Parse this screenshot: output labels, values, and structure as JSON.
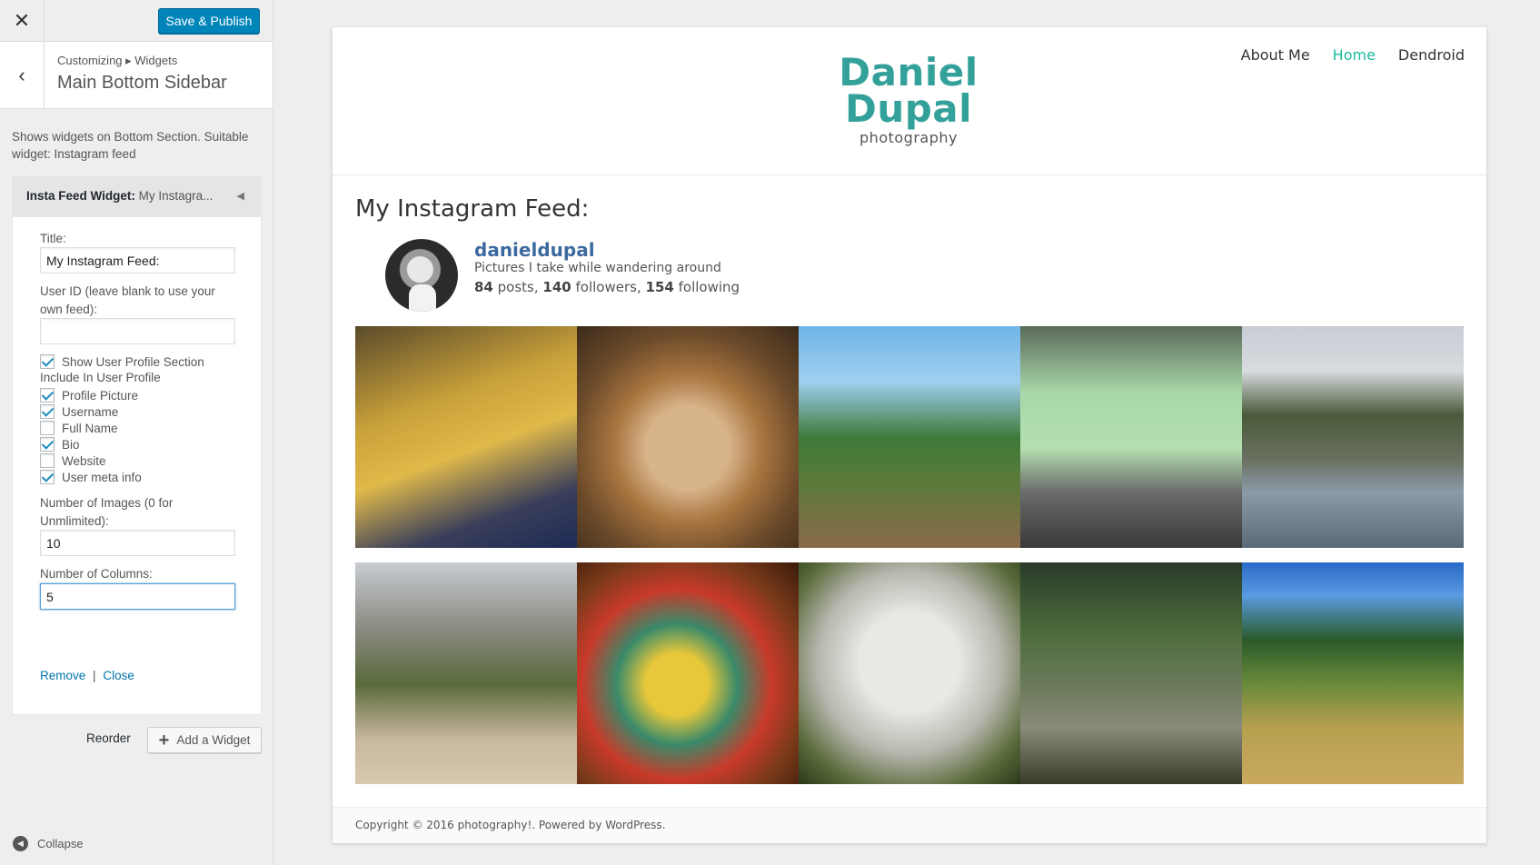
{
  "sidebar": {
    "close_icon": "close-icon",
    "save_label": "Save & Publish",
    "back_icon": "chevron-left-icon",
    "breadcrumb": "Customizing ▸ Widgets",
    "panel_title": "Main Bottom Sidebar",
    "description": "Shows widgets on Bottom Section. Suitable widget: Instagram feed",
    "widget": {
      "name": "Insta Feed Widget",
      "separator": ":",
      "instance_title": "My Instagra...",
      "toggle_icon": "arrow-left-icon",
      "title_label": "Title:",
      "title_value": "My Instagram Feed:",
      "userid_label": "User ID (leave blank to use your own feed):",
      "userid_value": "",
      "show_profile_label": "Show User Profile Section",
      "show_profile_checked": true,
      "include_label": "Include In User Profile",
      "options": [
        {
          "label": "Profile Picture",
          "checked": true
        },
        {
          "label": "Username",
          "checked": true
        },
        {
          "label": "Full Name",
          "checked": false
        },
        {
          "label": "Bio",
          "checked": true
        },
        {
          "label": "Website",
          "checked": false
        },
        {
          "label": "User meta info",
          "checked": true
        }
      ],
      "num_images_label": "Number of Images (0 for Unmlimited):",
      "num_images_value": "10",
      "num_columns_label": "Number of Columns:",
      "num_columns_value": "5",
      "remove_label": "Remove",
      "link_separator": "|",
      "close_label": "Close"
    },
    "reorder_label": "Reorder",
    "add_widget_label": "Add a Widget",
    "collapse_label": "Collapse"
  },
  "site": {
    "logo_line1": "Daniel",
    "logo_line2": "Dupal",
    "logo_line3": "photography",
    "nav": [
      {
        "label": "About Me",
        "active": false
      },
      {
        "label": "Home",
        "active": true
      },
      {
        "label": "Dendroid",
        "active": false
      }
    ],
    "feed_title": "My Instagram Feed:",
    "username": "danieldupal",
    "bio": "Pictures I take while wandering around",
    "posts": "84",
    "posts_label": "posts,",
    "followers": "140",
    "followers_label": "followers,",
    "following": "154",
    "following_label": "following",
    "photos": [
      "golden-amulets-photo",
      "stuffed-lynx-photo",
      "palm-tree-river-photo",
      "green-tuk-tuk-photo",
      "karst-bay-photo",
      "limestone-cliff-beach-photo",
      "naga-statue-photo",
      "stone-guardian-photo",
      "forest-boardwalk-photo",
      "rice-terrace-photo"
    ],
    "footer": "Copyright © 2016 photography!. Powered by WordPress."
  },
  "colors": {
    "accent": "#0085ba",
    "link": "#0073aa",
    "logo": "#33a19a",
    "nav_active": "#1abc9c"
  }
}
